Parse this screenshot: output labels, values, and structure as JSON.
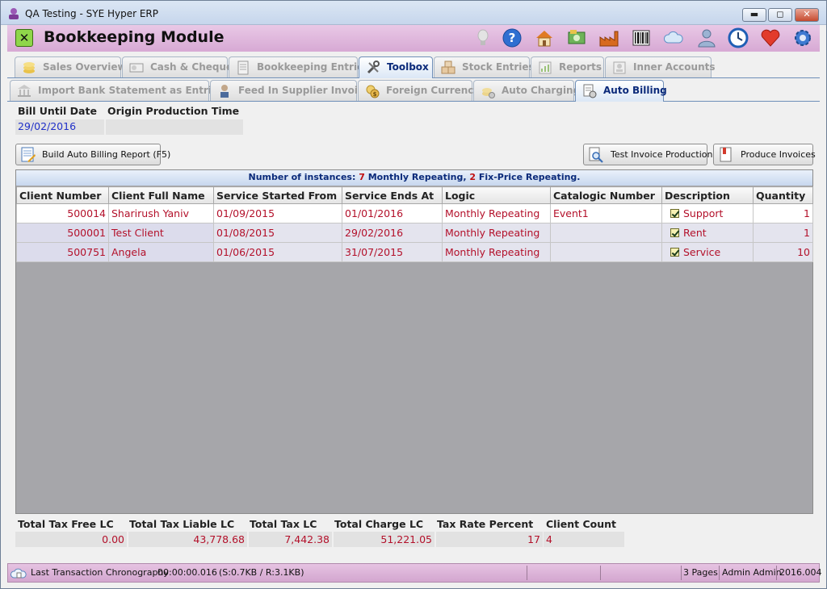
{
  "window": {
    "title": "QA Testing - SYE Hyper ERP",
    "minimize": "▬",
    "maximize": "◻",
    "close": "✕"
  },
  "module": {
    "title": "Bookkeeping Module",
    "close_glyph": "✕",
    "toolbar_icons": [
      "lightbulb-icon",
      "help-icon",
      "home-icon",
      "money-icon",
      "factory-icon",
      "barcode-icon",
      "cloud-icon",
      "users-icon",
      "clock-icon",
      "heart-icon",
      "gear-icon"
    ]
  },
  "main_tabs": [
    {
      "label": "Sales Overview",
      "icon": "coins-icon"
    },
    {
      "label": "Cash & Cheque",
      "icon": "cheque-icon"
    },
    {
      "label": "Bookkeeping Entries",
      "icon": "ledger-icon"
    },
    {
      "label": "Toolbox",
      "icon": "tools-icon"
    },
    {
      "label": "Stock Entries",
      "icon": "boxes-icon"
    },
    {
      "label": "Reports",
      "icon": "report-icon"
    },
    {
      "label": "Inner Accounts",
      "icon": "accounts-icon"
    }
  ],
  "sub_tabs": [
    {
      "label": "Import Bank Statement as Entries",
      "icon": "bank-icon"
    },
    {
      "label": "Feed In Supplier Invoice",
      "icon": "supplier-icon"
    },
    {
      "label": "Foreign Currency",
      "icon": "currency-icon"
    },
    {
      "label": "Auto Charging",
      "icon": "auto-charge-icon"
    },
    {
      "label": "Auto Billing",
      "icon": "auto-billing-icon"
    }
  ],
  "fields": {
    "bill_until_date_label": "Bill Until Date",
    "bill_until_date_value": "29/02/2016",
    "origin_production_time_label": "Origin Production Time",
    "origin_production_time_value": ""
  },
  "buttons": {
    "build_report": "Build Auto Billing Report  (F5)",
    "test_invoice_production": "Test Invoice Production",
    "produce_invoices": "Produce Invoices"
  },
  "instances": {
    "prefix": "Number of instances:",
    "monthly_count": "7",
    "monthly_label": "Monthly Repeating,",
    "fix_count": "2",
    "fix_label": "Fix-Price Repeating."
  },
  "table": {
    "columns": [
      "Client Number",
      "Client Full Name",
      "Service Started From",
      "Service Ends At",
      "Logic",
      "Catalogic Number",
      "Description",
      "Quantity"
    ],
    "rows": [
      {
        "client_number": "500014",
        "client_name": "Sharirush Yaniv",
        "started": "01/09/2015",
        "ends": "01/01/2016",
        "logic": "Monthly Repeating",
        "catalogic": "Event1",
        "description": "Support",
        "checked": true,
        "quantity": "1"
      },
      {
        "client_number": "500001",
        "client_name": "Test Client",
        "started": "01/08/2015",
        "ends": "29/02/2016",
        "logic": "Monthly Repeating",
        "catalogic": "",
        "description": "Rent",
        "checked": true,
        "quantity": "1"
      },
      {
        "client_number": "500751",
        "client_name": "Angela",
        "started": "01/06/2015",
        "ends": "31/07/2015",
        "logic": "Monthly Repeating",
        "catalogic": "",
        "description": "Service",
        "checked": true,
        "quantity": "10"
      }
    ]
  },
  "totals": {
    "tax_free_label": "Total Tax Free LC",
    "tax_free_value": "0.00",
    "tax_liable_label": "Total Tax Liable LC",
    "tax_liable_value": "43,778.68",
    "tax_label": "Total Tax LC",
    "tax_value": "7,442.38",
    "charge_label": "Total Charge LC",
    "charge_value": "51,221.05",
    "rate_label": "Tax Rate Percent",
    "rate_value": "17",
    "count_label": "Client Count",
    "count_value": "4"
  },
  "status": {
    "chronography_label": "Last Transaction Chronography",
    "chronography_time": "00:00:00.016",
    "sizes": "(S:0.7KB / R:3.1KB)",
    "pages": "3 Pages",
    "user": "Admin Admin",
    "version": "2016.004"
  },
  "colors": {
    "header_purple": "#d7a9d4",
    "accent_blue": "#0b2a7a",
    "data_red": "#b3102a"
  }
}
